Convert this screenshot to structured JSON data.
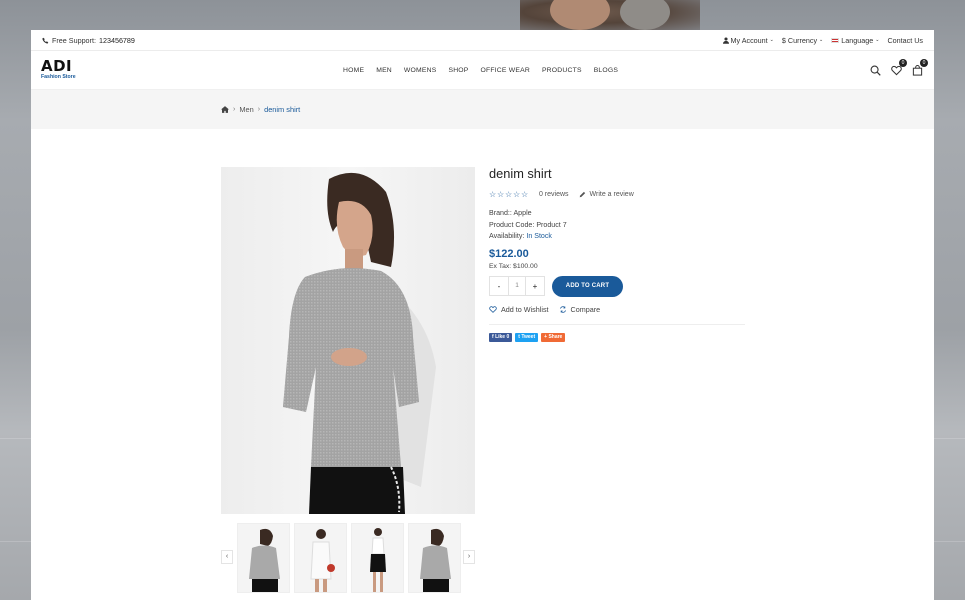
{
  "topbar": {
    "support_label": "Free Support:",
    "support_phone": "123456789",
    "my_account": "My Account",
    "currency_symbol": "$",
    "currency": "Currency",
    "language": "Language",
    "contact": "Contact Us"
  },
  "logo": {
    "mark": "ADI",
    "tagline": "Fashion Store"
  },
  "nav": [
    "HOME",
    "MEN",
    "WOMENS",
    "SHOP",
    "OFFICE WEAR",
    "PRODUCTS",
    "BLOGS"
  ],
  "header_icons": {
    "wishlist_count": "0",
    "cart_count": "0"
  },
  "breadcrumb": {
    "home_icon": "home-icon",
    "level1": "Men",
    "current": "denim shirt"
  },
  "product": {
    "title": "denim shirt",
    "rating_stars": "☆☆☆☆☆",
    "reviews": "0 reviews",
    "write_review": "Write a review",
    "brand": "Brand:: Apple",
    "code": "Product Code: Product 7",
    "availability_label": "Availability:",
    "availability_value": "In Stock",
    "price": "$122.00",
    "ex_tax": "Ex Tax: $100.00",
    "qty": "1",
    "qty_minus": "-",
    "qty_plus": "+",
    "add_to_cart": "ADD TO CART",
    "wishlist": "Add to Wishlist",
    "compare": "Compare"
  },
  "share": {
    "like": "Like 0",
    "tweet": "Tweet",
    "share": "Share"
  },
  "colors": {
    "accent": "#1a5a9a",
    "facebook": "#3b5998",
    "twitter": "#1da1f2",
    "share": "#f06a35"
  },
  "thumb_arrows": {
    "prev": "‹",
    "next": "›"
  }
}
